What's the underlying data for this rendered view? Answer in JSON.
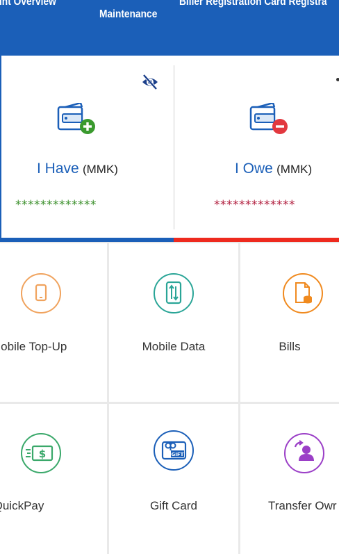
{
  "tabs": {
    "left": "ount Overview",
    "middle": "Maintenance",
    "right": "Biller Registration Card Registra"
  },
  "balance": {
    "have_label": "I Have",
    "have_unit": "(MMK)",
    "have_value": "*************",
    "owe_label": "I Owe",
    "owe_unit": "(MMK)",
    "owe_value": "*************"
  },
  "services": {
    "mobile_topup": "Mobile Top-Up",
    "mobile_data": "Mobile Data",
    "bills": "Bills",
    "quickpay": "QuickPay",
    "gift_card": "Gift Card",
    "transfer_ownership": "Transfer Owr"
  },
  "icons": {
    "hide_balance": "eye-slash-icon",
    "have_wallet": "wallet-plus-icon",
    "owe_wallet": "wallet-minus-icon",
    "mobile_topup": "phone-icon",
    "mobile_data": "phone-data-icon",
    "bills": "bill-coins-icon",
    "quickpay": "cash-dollar-icon",
    "gift_card": "gift-card-icon",
    "transfer": "user-transfer-icon"
  },
  "colors": {
    "primary": "#1b5fb8",
    "have_green": "#3a8f2a",
    "owe_red": "#b01c3c",
    "topup_orange": "#f0a35e",
    "data_teal": "#2aa597",
    "bills_orange": "#f08a1f",
    "quickpay_green": "#3aa86a",
    "giftcard_blue": "#1b5fb8",
    "transfer_purple": "#9b3fc7"
  }
}
